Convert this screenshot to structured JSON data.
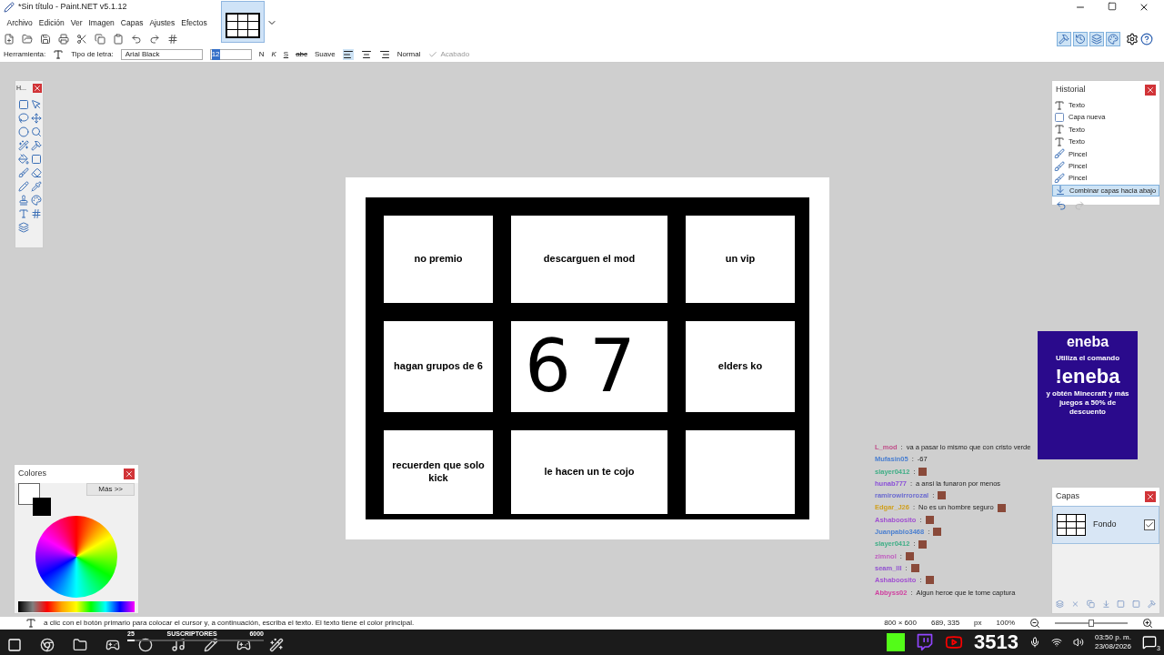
{
  "window": {
    "title": "*Sin título - Paint.NET v5.1.12"
  },
  "menu": [
    {
      "label": "Archivo"
    },
    {
      "label": "Edición"
    },
    {
      "label": "Ver"
    },
    {
      "label": "Imagen"
    },
    {
      "label": "Capas"
    },
    {
      "label": "Ajustes"
    },
    {
      "label": "Efectos"
    }
  ],
  "tool_options": {
    "tool_label": "Herramienta:",
    "font_label": "Tipo de letra:",
    "font": "Arial Black",
    "size": "12",
    "bold": "N",
    "italic": "K",
    "underline": "S",
    "strike": "abc",
    "antialias": "Suave",
    "blend": "Normal",
    "finish": "Acabado"
  },
  "canvas": {
    "cells": [
      {
        "text": "no premio",
        "kind": "typed"
      },
      {
        "text": "descarguen el mod",
        "kind": "typed"
      },
      {
        "text": "un vip",
        "kind": "typed"
      },
      {
        "text": "hagan grupos de 6",
        "kind": "typed"
      },
      {
        "text": "67",
        "kind": "handwritten"
      },
      {
        "text": "elders ko",
        "kind": "typed"
      },
      {
        "text": "recuerden que solo kick",
        "kind": "typed"
      },
      {
        "text": "le hacen un te cojo",
        "kind": "typed"
      },
      {
        "text": "",
        "kind": "empty"
      }
    ]
  },
  "tools_panel": {
    "title": "H..."
  },
  "colors_panel": {
    "title": "Colores",
    "more": "Más >>"
  },
  "history_panel": {
    "title": "Historial",
    "items": [
      {
        "label": "Texto",
        "kind": "text",
        "selected": false
      },
      {
        "label": "Capa nueva",
        "kind": "layer",
        "selected": false
      },
      {
        "label": "Texto",
        "kind": "text",
        "selected": false
      },
      {
        "label": "Texto",
        "kind": "text",
        "selected": false
      },
      {
        "label": "Pincel",
        "kind": "brush",
        "selected": false
      },
      {
        "label": "Pincel",
        "kind": "brush",
        "selected": false
      },
      {
        "label": "Pincel",
        "kind": "brush",
        "selected": false
      },
      {
        "label": "Combinar capas hacia abajo",
        "kind": "merge",
        "selected": true
      }
    ]
  },
  "layers_panel": {
    "title": "Capas",
    "layers": [
      {
        "name": "Fondo",
        "visible": true,
        "selected": true
      }
    ]
  },
  "ad": {
    "brand": "eneba",
    "line1": "Utiliza el comando",
    "command": "!eneba",
    "line2": "y obtén Minecraft y más juegos a 50% de descuento"
  },
  "chat": [
    {
      "user": "L_mod",
      "color": "#c0508a",
      "sep": ":",
      "message": "va a pasar lo mismo que con cristo verde"
    },
    {
      "user": "Mufasin05",
      "color": "#4a7fd0",
      "sep": ":",
      "message": "-67"
    },
    {
      "user": "slayer0412",
      "color": "#3fae86",
      "sep": ":",
      "emote": true
    },
    {
      "user": "hunab777",
      "color": "#8a4fd8",
      "sep": ":",
      "message": "a ansi la funaron por menos"
    },
    {
      "user": "ramirowirrorozal",
      "color": "#6a6ad0",
      "sep": ":",
      "emote": true
    },
    {
      "user": "Edgar_J26",
      "color": "#d0a020",
      "sep": ":",
      "message": "No es un hombre seguro",
      "emote": true
    },
    {
      "user": "Ashaboosito",
      "color": "#a050d0",
      "sep": ":",
      "emote": true
    },
    {
      "user": "Juanpablo3468",
      "color": "#4a7fd0",
      "sep": ":",
      "emote": true
    },
    {
      "user": "slayer0412",
      "color": "#3fae86",
      "sep": ":",
      "emote": true
    },
    {
      "user": "zimnol",
      "color": "#c060c0",
      "sep": ":",
      "emote": true
    },
    {
      "user": "seam_lll",
      "color": "#9050d0",
      "sep": ":",
      "emote": true
    },
    {
      "user": "Ashaboosito",
      "color": "#a050d0",
      "sep": ":",
      "emote": true
    },
    {
      "user": "Abbyss02",
      "color": "#d040a0",
      "sep": ":",
      "message": "Algun heroe que le tome captura"
    }
  ],
  "status_bar": {
    "hint": "a clic con el botón primario para colocar el cursor y, a continuación, escriba el texto. El texto tiene el color principal.",
    "image_size": "800 × 600",
    "cursor": "689, 335",
    "unit": "px",
    "zoom": "100%",
    "zoom_slider": {
      "level": 0.5
    }
  },
  "taskbar": {
    "subs_min": "25",
    "subs_label": "SUSCRIPTORES",
    "subs_max": "6000",
    "subs": {
      "level": 0.05
    },
    "viewers": "3513",
    "time": "03:50 p. m.",
    "date": "23/08/2026",
    "notifications": "3"
  }
}
